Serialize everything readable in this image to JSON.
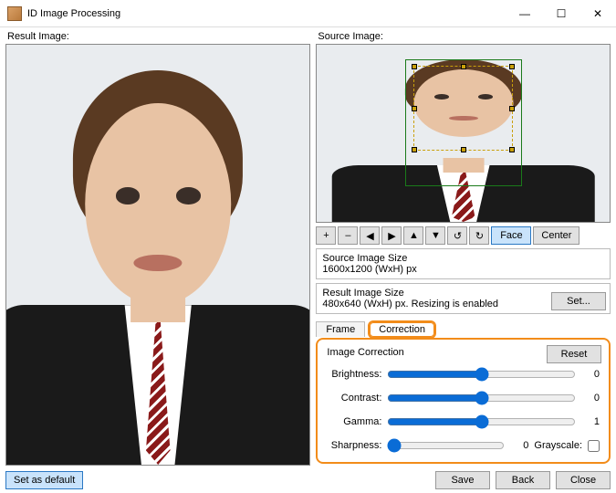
{
  "window": {
    "title": "ID Image Processing"
  },
  "left": {
    "label": "Result Image:",
    "set_default": "Set as default"
  },
  "right": {
    "label": "Source Image:",
    "toolbar": {
      "plus": "+",
      "minus": "–",
      "left": "◀",
      "right": "▶",
      "up": "▲",
      "down": "▼",
      "rot_ccw": "↺",
      "rot_cw": "↻",
      "face": "Face",
      "center": "Center"
    },
    "source_info": {
      "title": "Source Image Size",
      "value": "1600x1200 (WxH) px"
    },
    "result_info": {
      "title": "Result Image Size",
      "value": "480x640 (WxH) px. Resizing is enabled",
      "set": "Set..."
    },
    "tabs": {
      "frame": "Frame",
      "correction": "Correction"
    },
    "correction": {
      "title": "Image Correction",
      "reset": "Reset",
      "brightness": {
        "label": "Brightness:",
        "value": "0"
      },
      "contrast": {
        "label": "Contrast:",
        "value": "0"
      },
      "gamma": {
        "label": "Gamma:",
        "value": "1"
      },
      "sharpness": {
        "label": "Sharpness:",
        "value": "0"
      },
      "grayscale": "Grayscale:"
    },
    "buttons": {
      "save": "Save",
      "back": "Back",
      "close": "Close"
    }
  }
}
